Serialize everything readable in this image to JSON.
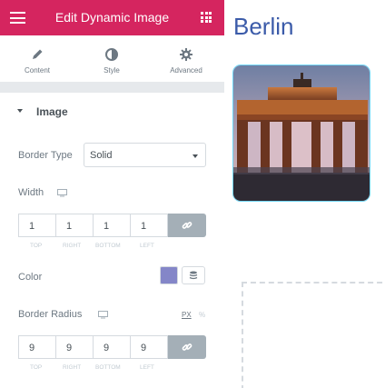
{
  "header": {
    "title": "Edit Dynamic Image",
    "bg_color": "#d5255f",
    "menu_icon": "hamburger-icon",
    "apps_icon": "grid-icon"
  },
  "tabs": [
    {
      "label": "Content",
      "icon": "pencil-icon"
    },
    {
      "label": "Style",
      "icon": "half-circle-icon"
    },
    {
      "label": "Advanced",
      "icon": "gear-icon"
    }
  ],
  "section": {
    "title": "Image",
    "icon": "caret-down-icon"
  },
  "border_type": {
    "label": "Border Type",
    "value": "Solid"
  },
  "width": {
    "label": "Width",
    "values": [
      "1",
      "1",
      "1",
      "1"
    ],
    "sides": [
      "TOP",
      "RIGHT",
      "BOTTOM",
      "LEFT"
    ],
    "link_icon": "link-icon",
    "device_icon": "desktop-icon"
  },
  "color": {
    "label": "Color",
    "value": "#8486c8",
    "globe_icon": "stack-icon"
  },
  "border_radius": {
    "label": "Border Radius",
    "values": [
      "9",
      "9",
      "9",
      "9"
    ],
    "sides": [
      "TOP",
      "RIGHT",
      "BOTTOM",
      "LEFT"
    ],
    "units": [
      "PX",
      "%"
    ],
    "link_icon": "link-icon",
    "device_icon": "desktop-icon"
  },
  "preview": {
    "heading": "Berlin",
    "heading_color": "#3b5ba9",
    "image": "brandenburg-gate-photo"
  }
}
